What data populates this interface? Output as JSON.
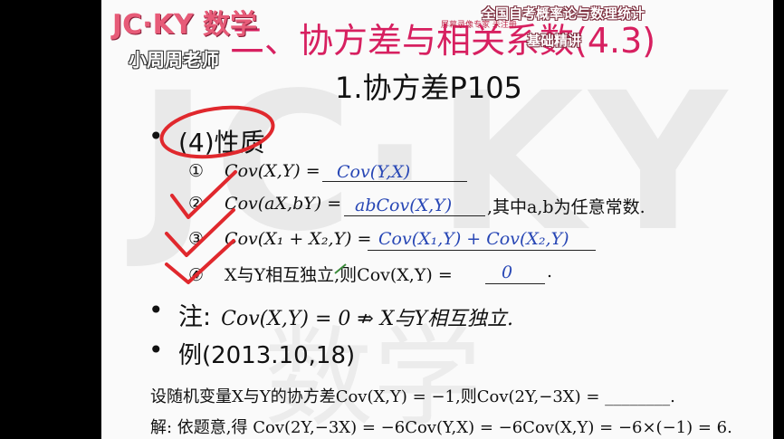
{
  "logo": {
    "text": "JC·KY 数学"
  },
  "teacher": {
    "name": "小周周老师"
  },
  "stamp": {
    "text": "屏幕录像专家 未注册"
  },
  "chapter_title": "二、协方差与相关系数(4.3)",
  "course": {
    "line1": "全国自考概率论与数理统计",
    "line2": "基础精讲"
  },
  "section_title": "1.协方差P105",
  "watermark": {
    "text": "JC·KY",
    "text2": "数学"
  },
  "property": {
    "bullet": "•",
    "label": "(4)性质"
  },
  "items": [
    {
      "num": "①",
      "text": "Cov(X,Y) =",
      "answer": "Cov(Y,X)",
      "suffix": ""
    },
    {
      "num": "②",
      "text": "Cov(aX,bY) =",
      "answer": "abCov(X,Y)",
      "suffix": ",其中a,b为任意常数."
    },
    {
      "num": "③",
      "text": "Cov(X₁ + X₂,Y) =",
      "answer": "Cov(X₁,Y) + Cov(X₂,Y)",
      "suffix": ""
    },
    {
      "num": "④",
      "text": "X与Y相互独立,则Cov(X,Y) =",
      "answer": "0",
      "suffix": "."
    }
  ],
  "note": {
    "bullet": "•",
    "label": "注:",
    "text": "Cov(X,Y) = 0 ⇏ X与Y相互独立."
  },
  "example": {
    "bullet": "•",
    "label": "例(2013.10,18)"
  },
  "question": "设随机变量X与Y的协方差Cov(X,Y) = −1,则Cov(2Y,−3X) = ________.",
  "solution": "解: 依题意,得  Cov(2Y,−3X) = −6Cov(Y,X) = −6Cov(X,Y) = −6×(−1) = 6.",
  "colors": {
    "accent": "#d72060",
    "answer": "#2847b5",
    "pen": "#e0282d"
  }
}
